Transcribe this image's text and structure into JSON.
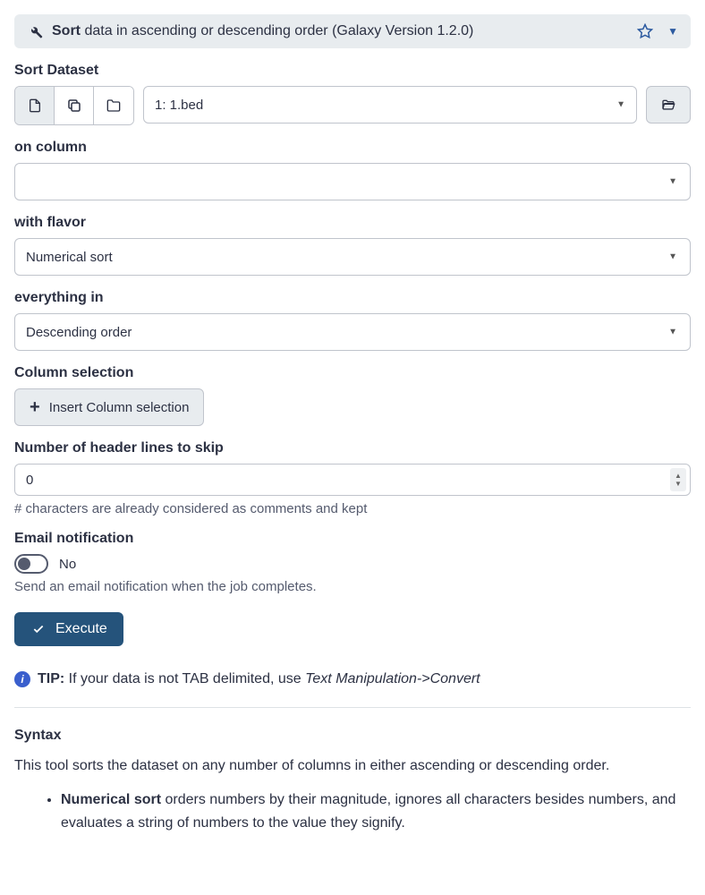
{
  "header": {
    "tool_name": "Sort",
    "description": " data in ascending or descending order (Galaxy Version 1.2.0)"
  },
  "fields": {
    "sort_dataset": {
      "label": "Sort Dataset",
      "value": "1: 1.bed"
    },
    "on_column": {
      "label": "on column",
      "value": ""
    },
    "with_flavor": {
      "label": "with flavor",
      "value": "Numerical sort"
    },
    "everything_in": {
      "label": "everything in",
      "value": "Descending order"
    },
    "column_selection": {
      "label": "Column selection",
      "button": "Insert Column selection"
    },
    "header_lines": {
      "label": "Number of header lines to skip",
      "value": "0",
      "help": "# characters are already considered as comments and kept"
    },
    "email": {
      "label": "Email notification",
      "state": "No",
      "help": "Send an email notification when the job completes."
    }
  },
  "execute": "Execute",
  "tip": {
    "prefix": "TIP:",
    "text": " If your data is not TAB delimited, use ",
    "em": "Text Manipulation->Convert"
  },
  "syntax": {
    "heading": "Syntax",
    "body": "This tool sorts the dataset on any number of columns in either ascending or descending order.",
    "item_bold": "Numerical sort",
    "item_rest": " orders numbers by their magnitude, ignores all characters besides numbers, and evaluates a string of numbers to the value they signify."
  }
}
